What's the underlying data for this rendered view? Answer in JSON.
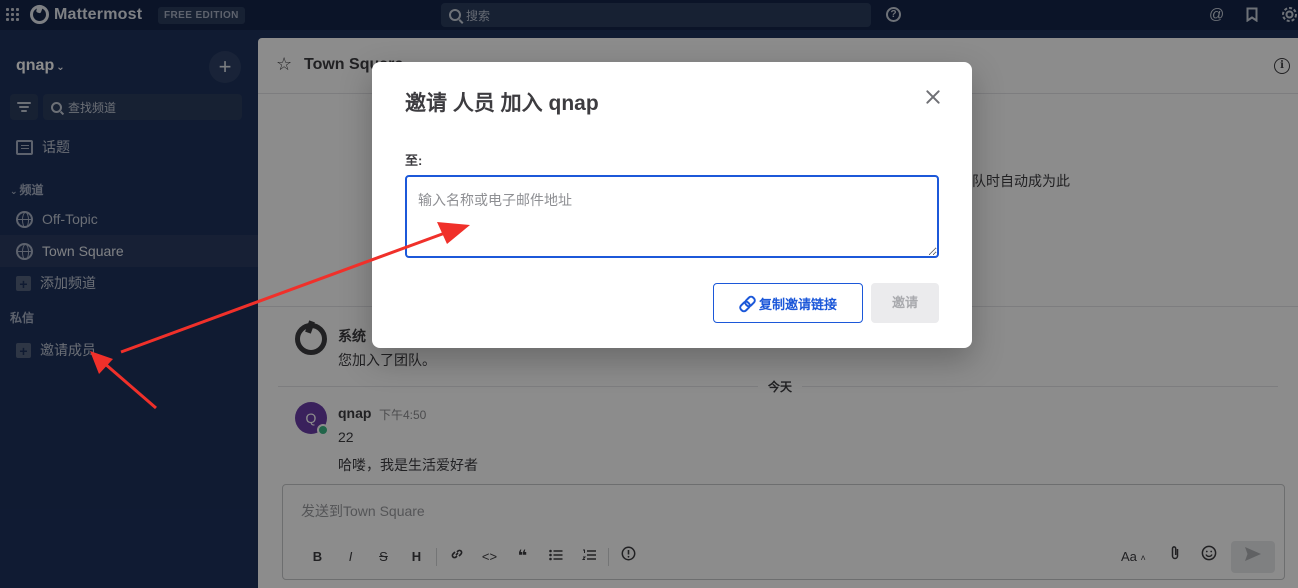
{
  "header": {
    "brand": "Mattermost",
    "edition": "FREE EDITION",
    "search_placeholder": "搜索",
    "help_icon": "help-circle-icon",
    "at_icon": "at-mention-icon",
    "saved_icon": "bookmark-icon",
    "settings_icon": "gear-icon"
  },
  "sidebar": {
    "team": "qnap",
    "find_channel": "查找频道",
    "threads": "话题",
    "channels_section": "频道",
    "channels": [
      {
        "label": "Off-Topic",
        "icon": "globe-icon",
        "active": false
      },
      {
        "label": "Town Square",
        "icon": "globe-icon",
        "active": true
      }
    ],
    "add_channel": "添加频道",
    "dm_section": "私信",
    "invite_members": "邀请成员"
  },
  "main": {
    "channel_title": "Town Square",
    "intro_partial": "团队时自动成为此",
    "system_post": {
      "author": "系统",
      "text": "您加入了团队。"
    },
    "date_separator": "今天",
    "user_post": {
      "avatar_letter": "Q",
      "author": "qnap",
      "time": "下午4:50",
      "lines": [
        "22",
        "哈喽，我是生活爱好者"
      ]
    },
    "composer_placeholder": "发送到Town Square",
    "format_buttons": [
      "B",
      "I",
      "S",
      "H"
    ],
    "text_size_label": "Aa"
  },
  "modal": {
    "title": "邀请 人员 加入 qnap",
    "to_label": "至:",
    "input_placeholder": "输入名称或电子邮件地址",
    "copy_link_label": "复制邀请链接",
    "invite_label": "邀请"
  },
  "colors": {
    "sidebar_bg": "#1e325c",
    "header_bg": "#15264a",
    "accent": "#1c58d9",
    "annotation_arrow": "#f0302a"
  }
}
